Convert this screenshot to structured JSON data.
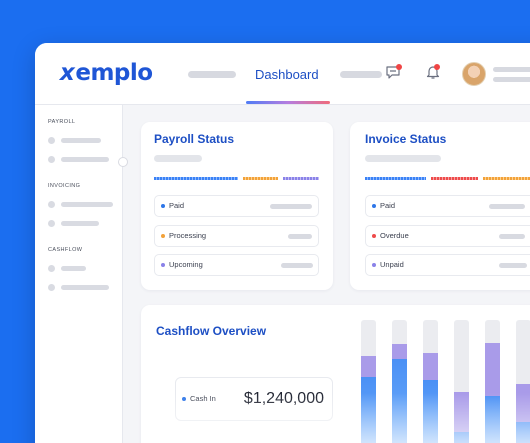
{
  "header": {
    "logo": "xemplo",
    "active_tab": "Dashboard"
  },
  "sidebar": {
    "sections": [
      {
        "title": "PAYROLL"
      },
      {
        "title": "INVOICING"
      },
      {
        "title": "CASHFLOW"
      }
    ]
  },
  "payroll": {
    "title": "Payroll Status",
    "rows": [
      {
        "label": "Paid",
        "color": "#2e76e8"
      },
      {
        "label": "Processing",
        "color": "#f2a23a"
      },
      {
        "label": "Upcoming",
        "color": "#8a82e8"
      }
    ]
  },
  "invoice": {
    "title": "Invoice Status",
    "rows": [
      {
        "label": "Paid",
        "color": "#2e76e8"
      },
      {
        "label": "Overdue",
        "color": "#ee4b4b"
      },
      {
        "label": "Unpaid",
        "color": "#8a82e8"
      }
    ]
  },
  "cashflow": {
    "title": "Cashflow Overview",
    "cash_in_label": "Cash In",
    "cash_in_value": "$1,240,000"
  },
  "chart_data": {
    "type": "bar",
    "series_colors": [
      "#4a90f5",
      "#a99be9",
      "#ebecf0"
    ],
    "stacked_fraction": [
      {
        "blue": 0.6,
        "lavender": 0.15
      },
      {
        "blue": 0.73,
        "lavender": 0.1
      },
      {
        "blue": 0.58,
        "lavender": 0.19
      },
      {
        "blue": 0.22,
        "lavender": 0.28
      },
      {
        "blue": 0.47,
        "lavender": 0.37
      },
      {
        "blue": 0.29,
        "lavender": 0.26
      }
    ]
  }
}
